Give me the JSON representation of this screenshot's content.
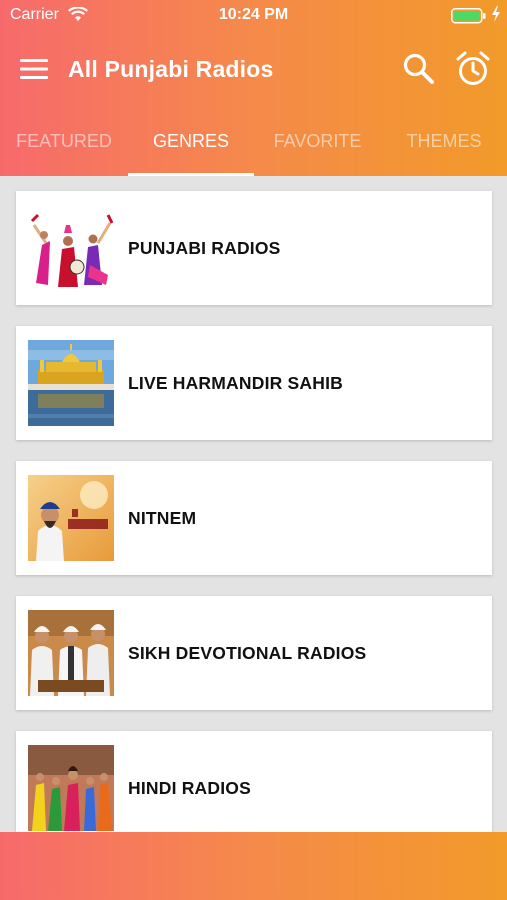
{
  "status_bar": {
    "carrier": "Carrier",
    "time": "10:24 PM"
  },
  "toolbar": {
    "title": "All Punjabi Radios",
    "icons": [
      "menu-icon",
      "search-icon",
      "alarm-clock-icon"
    ]
  },
  "tabs": [
    {
      "label": "FEATURED",
      "active": false
    },
    {
      "label": "GENRES",
      "active": true
    },
    {
      "label": "FAVORITE",
      "active": false
    },
    {
      "label": "THEMES",
      "active": false
    }
  ],
  "genres": [
    {
      "label": "PUNJABI RADIOS"
    },
    {
      "label": "LIVE HARMANDIR SAHIB"
    },
    {
      "label": "NITNEM"
    },
    {
      "label": "SIKH DEVOTIONAL RADIOS"
    },
    {
      "label": "HINDI RADIOS"
    }
  ],
  "colors": {
    "gradient_start": "#f76a6c",
    "gradient_end": "#f29a2a",
    "background": "#e3e3e3",
    "battery": "#4cd964"
  }
}
